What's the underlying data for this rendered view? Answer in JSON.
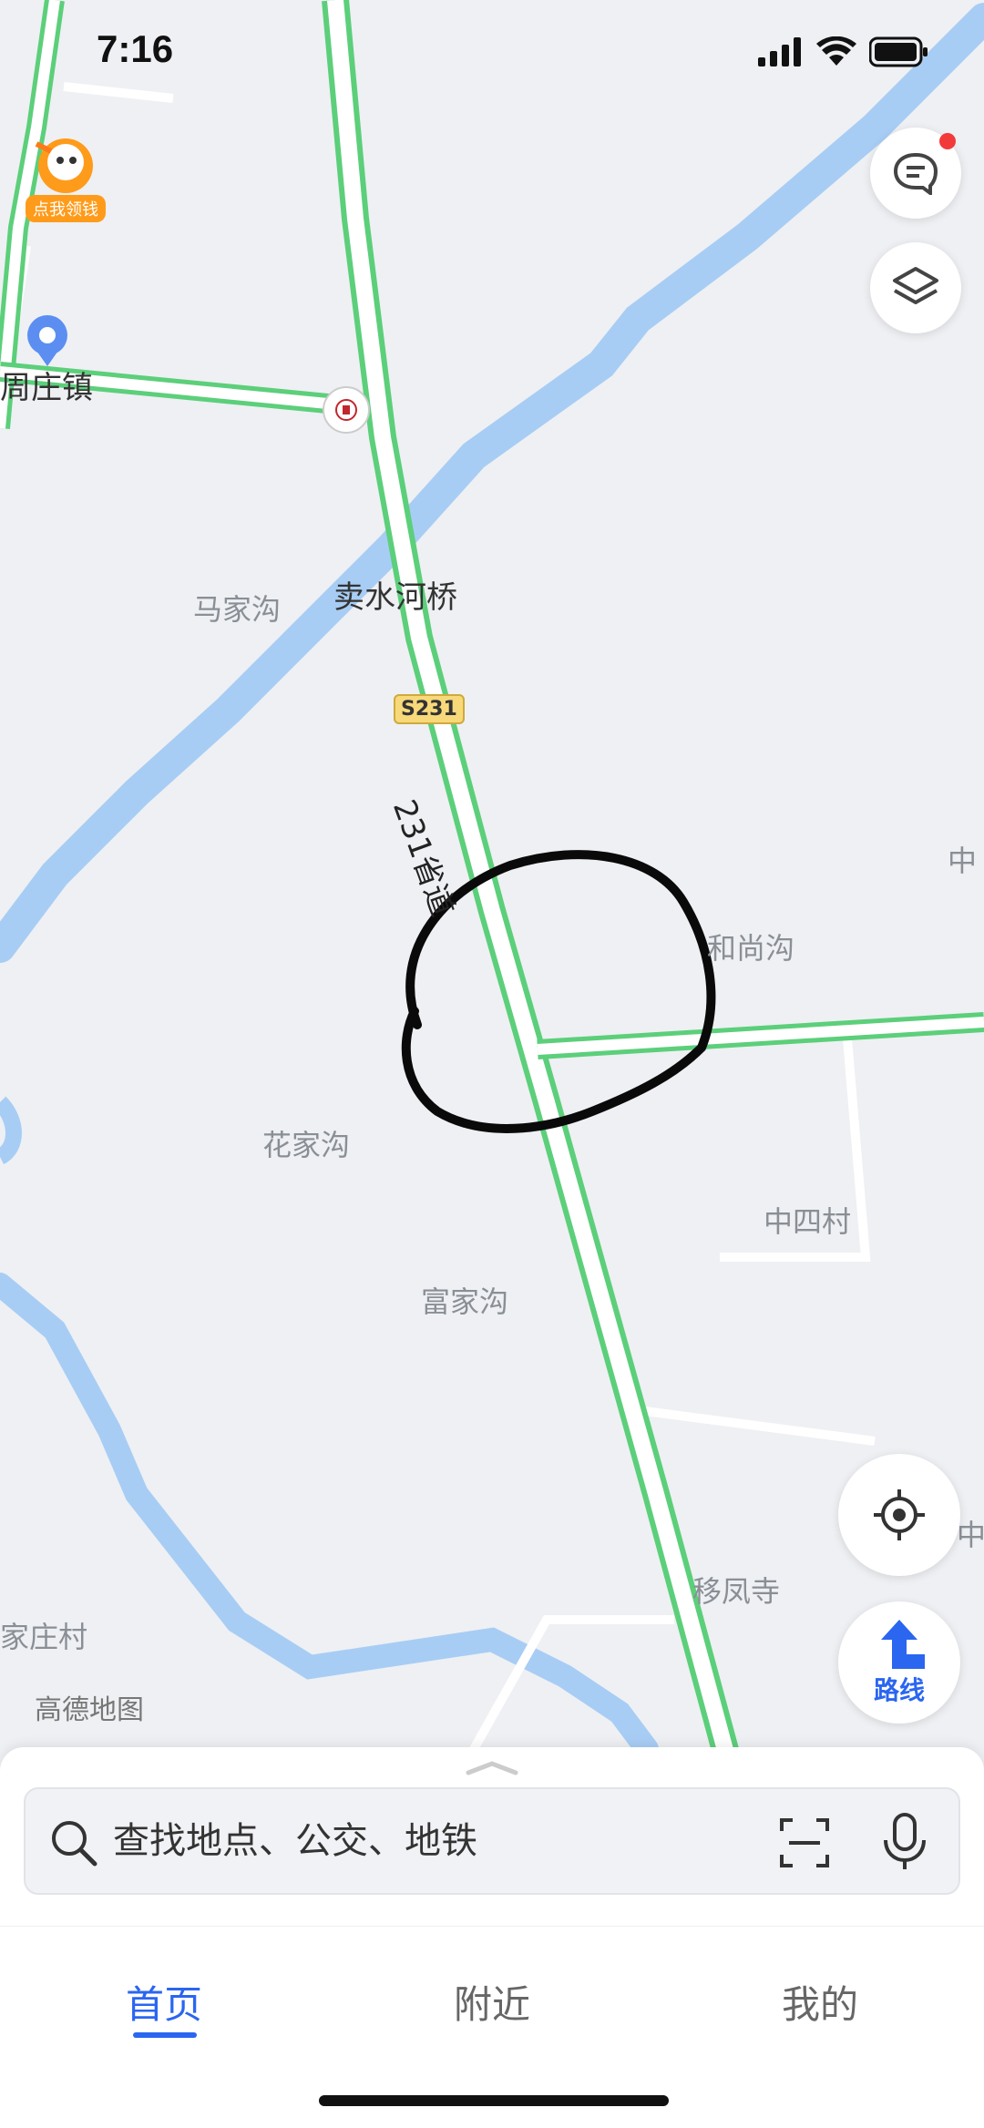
{
  "status_bar": {
    "time": "7:16"
  },
  "map": {
    "labels": {
      "zhouzhuang": "周庄镇",
      "majiagou": "马家沟",
      "maishuihe_bridge": "卖水河桥",
      "road_shield": "S231",
      "road_name": "231省道",
      "heshanggou": "和尚沟",
      "zhong_partial_top": "中",
      "huajiagou": "花家沟",
      "zhongsi_village": "中四村",
      "fujiagou": "富家沟",
      "zhong_partial_bottom": "中",
      "yifeng_temple": "移凤寺",
      "jiazhuang_village": "家庄村"
    },
    "promo_badge": "点我领钱",
    "watermark": "高德地图",
    "colors": {
      "road_green": "#5ccf7a",
      "river_blue": "#a8cdf4",
      "background": "#eef0f3",
      "circle_mark": "#0a0a0a"
    }
  },
  "floating_controls": {
    "message_icon": "message-icon",
    "layers_icon": "layers-icon",
    "locate_icon": "locate-icon",
    "route_label": "路线"
  },
  "search": {
    "placeholder": "查找地点、公交、地铁"
  },
  "tabs": [
    {
      "label": "首页",
      "active": true
    },
    {
      "label": "附近",
      "active": false
    },
    {
      "label": "我的",
      "active": false
    }
  ]
}
